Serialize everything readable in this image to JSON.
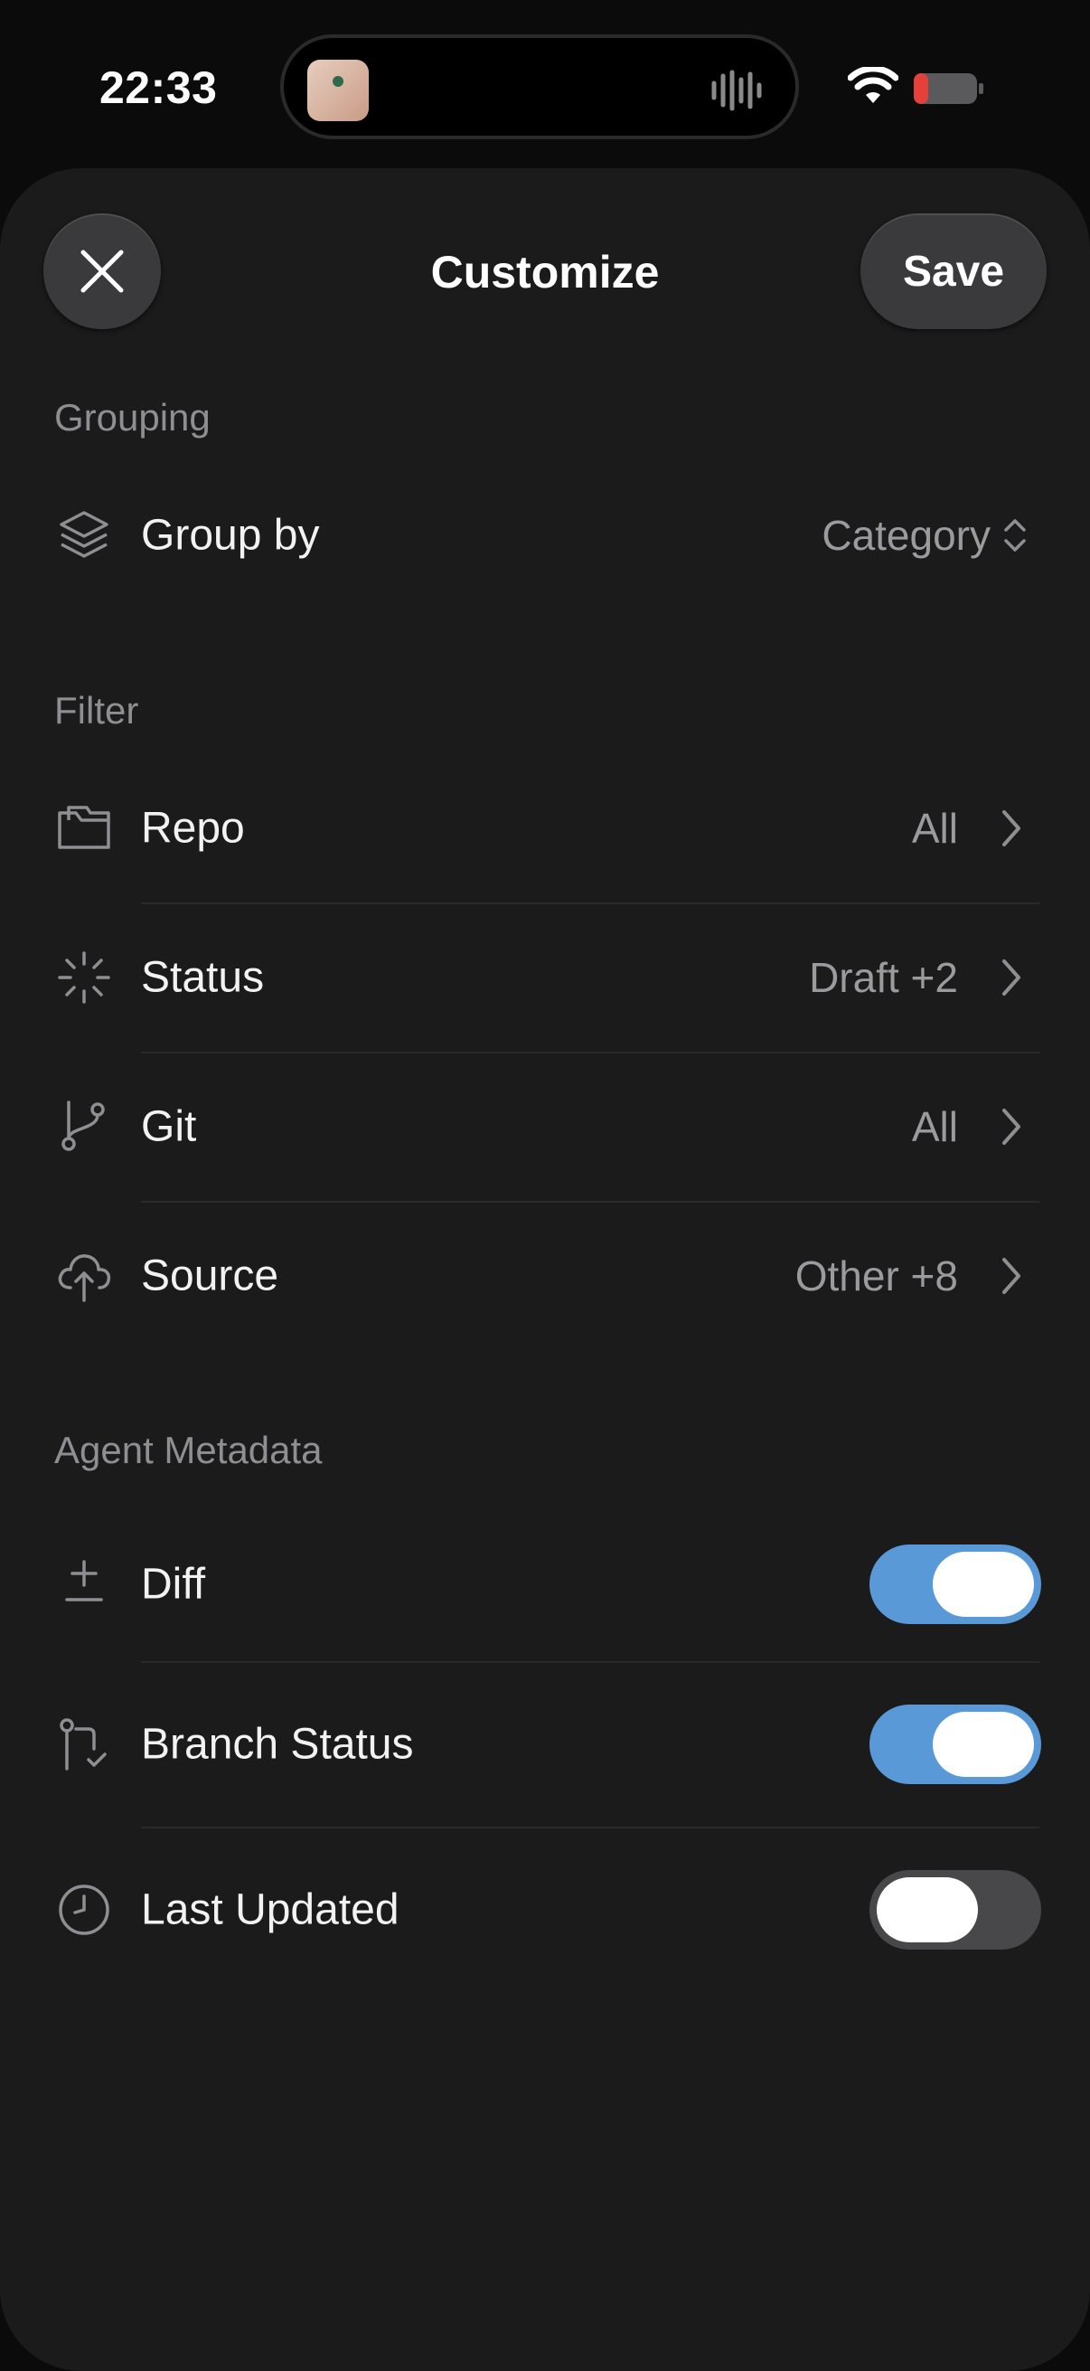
{
  "status_bar": {
    "time": "22:33"
  },
  "header": {
    "title": "Customize",
    "save_label": "Save"
  },
  "grouping": {
    "section_label": "Grouping",
    "group_by": {
      "label": "Group by",
      "value": "Category"
    }
  },
  "filter": {
    "section_label": "Filter",
    "rows": [
      {
        "label": "Repo",
        "value": "All",
        "icon": "folder-icon"
      },
      {
        "label": "Status",
        "value": "Draft +2",
        "icon": "loader-icon"
      },
      {
        "label": "Git",
        "value": "All",
        "icon": "git-branch-icon"
      },
      {
        "label": "Source",
        "value": "Other +8",
        "icon": "upload-cloud-icon"
      }
    ]
  },
  "agent_metadata": {
    "section_label": "Agent Metadata",
    "rows": [
      {
        "label": "Diff",
        "enabled": true,
        "icon": "plus-minus-icon"
      },
      {
        "label": "Branch Status",
        "enabled": true,
        "icon": "git-pull-check-icon"
      },
      {
        "label": "Last Updated",
        "enabled": false,
        "icon": "clock-icon"
      }
    ]
  },
  "colors": {
    "sheet_bg": "#1b1b1c",
    "toggle_on": "#5a99d8",
    "toggle_off": "#48484a",
    "secondary_text": "#9a9a9f"
  }
}
